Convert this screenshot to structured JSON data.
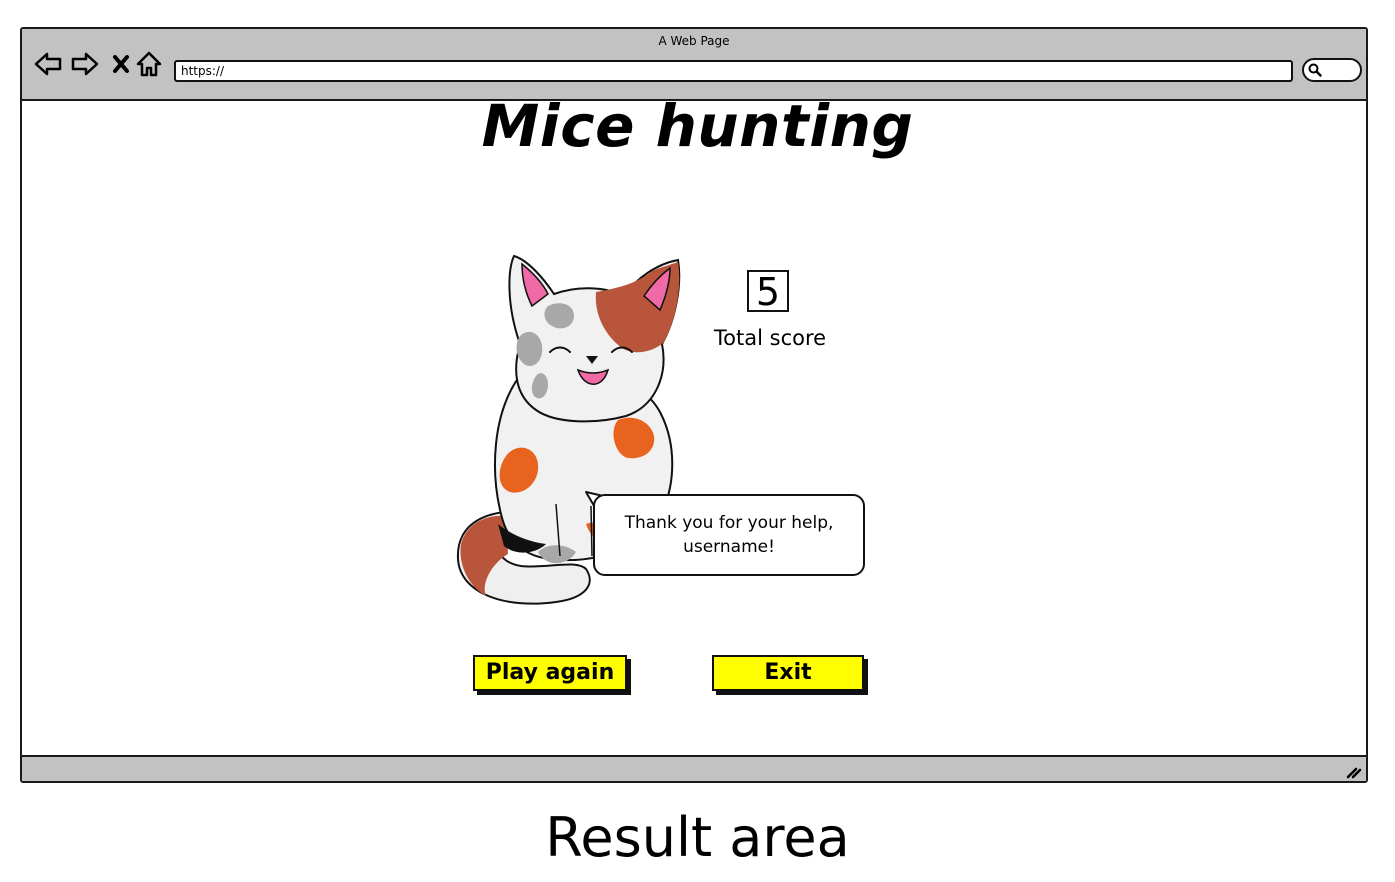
{
  "window": {
    "title": "A Web Page"
  },
  "toolbar": {
    "icons": [
      "back-arrow-icon",
      "forward-arrow-icon",
      "close-icon",
      "home-icon",
      "search-icon"
    ],
    "url": "https://"
  },
  "page": {
    "title": "Mice hunting",
    "score": {
      "value": "5",
      "label": "Total score"
    },
    "speech": {
      "line1": "Thank you for your help,",
      "line2": "username!"
    },
    "buttons": {
      "play_again": "Play again",
      "exit": "Exit"
    }
  },
  "caption": "Result area",
  "colors": {
    "chrome": "#c2c2c2",
    "button": "#ffff00",
    "cat_orange": "#e8641e",
    "cat_brown": "#b9553a",
    "cat_gray": "#a8a8a8",
    "ear_pink": "#f06aa8"
  }
}
